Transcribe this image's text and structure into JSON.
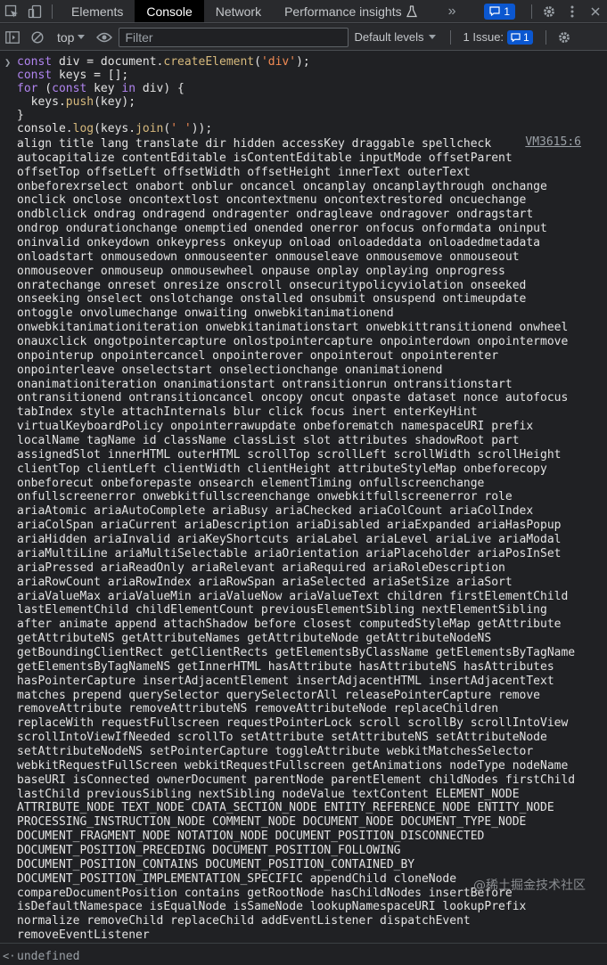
{
  "tabbar": {
    "tabs": [
      {
        "label": "Elements",
        "active": false
      },
      {
        "label": "Console",
        "active": true
      },
      {
        "label": "Network",
        "active": false
      },
      {
        "label": "Performance insights",
        "active": false
      }
    ],
    "more_symbol": "»",
    "messages_count": "1"
  },
  "toolbar": {
    "context": "top",
    "filter_placeholder": "Filter",
    "levels_label": "Default levels",
    "issues_label": "1 Issue:",
    "issues_count": "1"
  },
  "console": {
    "source_link": "VM3615:6",
    "result": "undefined",
    "output_lines": [
      "align title lang translate dir hidden accessKey draggable spellcheck",
      "autocapitalize contentEditable isContentEditable inputMode offsetParent",
      "offsetTop offsetLeft offsetWidth offsetHeight innerText outerText",
      "onbeforexrselect onabort onblur oncancel oncanplay oncanplaythrough onchange",
      "onclick onclose oncontextlost oncontextmenu oncontextrestored oncuechange",
      "ondblclick ondrag ondragend ondragenter ondragleave ondragover ondragstart",
      "ondrop ondurationchange onemptied onended onerror onfocus onformdata oninput",
      "oninvalid onkeydown onkeypress onkeyup onload onloadeddata onloadedmetadata",
      "onloadstart onmousedown onmouseenter onmouseleave onmousemove onmouseout",
      "onmouseover onmouseup onmousewheel onpause onplay onplaying onprogress",
      "onratechange onreset onresize onscroll onsecuritypolicyviolation onseeked",
      "onseeking onselect onslotchange onstalled onsubmit onsuspend ontimeupdate",
      "ontoggle onvolumechange onwaiting onwebkitanimationend",
      "onwebkitanimationiteration onwebkitanimationstart onwebkittransitionend onwheel",
      "onauxclick ongotpointercapture onlostpointercapture onpointerdown onpointermove",
      "onpointerup onpointercancel onpointerover onpointerout onpointerenter",
      "onpointerleave onselectstart onselectionchange onanimationend",
      "onanimationiteration onanimationstart ontransitionrun ontransitionstart",
      "ontransitionend ontransitioncancel oncopy oncut onpaste dataset nonce autofocus",
      "tabIndex style attachInternals blur click focus inert enterKeyHint",
      "virtualKeyboardPolicy onpointerrawupdate onbeforematch namespaceURI prefix",
      "localName tagName id className classList slot attributes shadowRoot part",
      "assignedSlot innerHTML outerHTML scrollTop scrollLeft scrollWidth scrollHeight",
      "clientTop clientLeft clientWidth clientHeight attributeStyleMap onbeforecopy",
      "onbeforecut onbeforepaste onsearch elementTiming onfullscreenchange",
      "onfullscreenerror onwebkitfullscreenchange onwebkitfullscreenerror role",
      "ariaAtomic ariaAutoComplete ariaBusy ariaChecked ariaColCount ariaColIndex",
      "ariaColSpan ariaCurrent ariaDescription ariaDisabled ariaExpanded ariaHasPopup",
      "ariaHidden ariaInvalid ariaKeyShortcuts ariaLabel ariaLevel ariaLive ariaModal",
      "ariaMultiLine ariaMultiSelectable ariaOrientation ariaPlaceholder ariaPosInSet",
      "ariaPressed ariaReadOnly ariaRelevant ariaRequired ariaRoleDescription",
      "ariaRowCount ariaRowIndex ariaRowSpan ariaSelected ariaSetSize ariaSort",
      "ariaValueMax ariaValueMin ariaValueNow ariaValueText children firstElementChild",
      "lastElementChild childElementCount previousElementSibling nextElementSibling",
      "after animate append attachShadow before closest computedStyleMap getAttribute",
      "getAttributeNS getAttributeNames getAttributeNode getAttributeNodeNS",
      "getBoundingClientRect getClientRects getElementsByClassName getElementsByTagName",
      "getElementsByTagNameNS getInnerHTML hasAttribute hasAttributeNS hasAttributes",
      "hasPointerCapture insertAdjacentElement insertAdjacentHTML insertAdjacentText",
      "matches prepend querySelector querySelectorAll releasePointerCapture remove",
      "removeAttribute removeAttributeNS removeAttributeNode replaceChildren",
      "replaceWith requestFullscreen requestPointerLock scroll scrollBy scrollIntoView",
      "scrollIntoViewIfNeeded scrollTo setAttribute setAttributeNS setAttributeNode",
      "setAttributeNodeNS setPointerCapture toggleAttribute webkitMatchesSelector",
      "webkitRequestFullScreen webkitRequestFullscreen getAnimations nodeType nodeName",
      "baseURI isConnected ownerDocument parentNode parentElement childNodes firstChild",
      "lastChild previousSibling nextSibling nodeValue textContent ELEMENT_NODE",
      "ATTRIBUTE_NODE TEXT_NODE CDATA_SECTION_NODE ENTITY_REFERENCE_NODE ENTITY_NODE",
      "PROCESSING_INSTRUCTION_NODE COMMENT_NODE DOCUMENT_NODE DOCUMENT_TYPE_NODE",
      "DOCUMENT_FRAGMENT_NODE NOTATION_NODE DOCUMENT_POSITION_DISCONNECTED",
      "DOCUMENT_POSITION_PRECEDING DOCUMENT_POSITION_FOLLOWING",
      "DOCUMENT_POSITION_CONTAINS DOCUMENT_POSITION_CONTAINED_BY",
      "DOCUMENT_POSITION_IMPLEMENTATION_SPECIFIC appendChild cloneNode",
      "compareDocumentPosition contains getRootNode hasChildNodes insertBefore",
      "isDefaultNamespace isEqualNode isSameNode lookupNamespaceURI lookupPrefix",
      "normalize removeChild replaceChild addEventListener dispatchEvent",
      "removeEventListener"
    ]
  },
  "watermark": "@稀土掘金技术社区"
}
